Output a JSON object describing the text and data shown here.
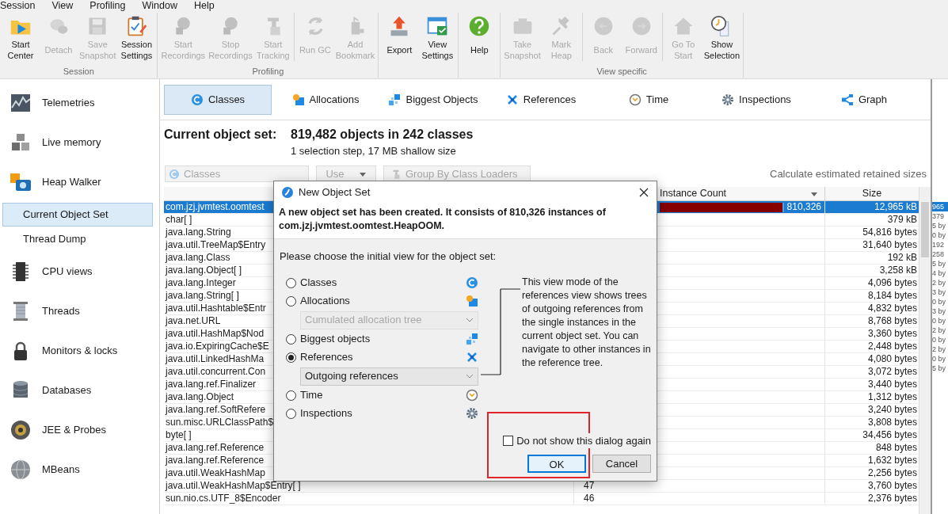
{
  "menu": [
    {
      "label": "Session"
    },
    {
      "label": "View"
    },
    {
      "label": "Profiling"
    },
    {
      "label": "Window"
    },
    {
      "label": "Help"
    }
  ],
  "toolbar": {
    "groups": [
      {
        "label": "Session",
        "sections": [
          [
            {
              "label": "Start\nCenter",
              "disabled": false
            },
            {
              "label": "Detach",
              "disabled": true
            },
            {
              "label": "Save\nSnapshot",
              "disabled": true
            },
            {
              "label": "Session\nSettings",
              "disabled": false
            }
          ]
        ]
      },
      {
        "label": "Profiling",
        "sections": [
          [
            {
              "label": "Start\nRecordings",
              "disabled": true
            },
            {
              "label": "Stop\nRecordings",
              "disabled": true
            },
            {
              "label": "Start\nTracking",
              "disabled": true
            }
          ],
          [
            {
              "label": "Run GC",
              "disabled": true
            },
            {
              "label": "Add\nBookmark",
              "disabled": true
            }
          ]
        ]
      },
      {
        "sections": [
          [
            {
              "label": "Export",
              "disabled": false
            },
            {
              "label": "View\nSettings",
              "disabled": false
            }
          ]
        ]
      },
      {
        "sections": [
          [
            {
              "label": "Help",
              "disabled": false
            }
          ]
        ]
      },
      {
        "label": "View specific",
        "sections": [
          [
            {
              "label": "Take\nSnapshot",
              "disabled": true
            },
            {
              "label": "Mark\nHeap",
              "disabled": true
            }
          ],
          [
            {
              "label": "Back",
              "disabled": true
            },
            {
              "label": "Forward",
              "disabled": true
            }
          ],
          [
            {
              "label": "Go To\nStart",
              "disabled": true
            },
            {
              "label": "Show\nSelection",
              "disabled": false
            }
          ]
        ]
      }
    ]
  },
  "sidebar": {
    "items": [
      {
        "label": "Telemetries",
        "selected": false
      },
      {
        "label": "Live memory",
        "selected": false
      },
      {
        "label": "Heap Walker",
        "selected": false,
        "children": [
          {
            "label": "Current Object Set",
            "selected": true
          },
          {
            "label": "Thread Dump",
            "selected": false
          }
        ]
      },
      {
        "label": "CPU views",
        "selected": false
      },
      {
        "label": "Threads",
        "selected": false
      },
      {
        "label": "Monitors & locks",
        "selected": false
      },
      {
        "label": "Databases",
        "selected": false
      },
      {
        "label": "JEE & Probes",
        "selected": false
      },
      {
        "label": "MBeans",
        "selected": false
      }
    ]
  },
  "view_tabs": [
    {
      "label": "Classes",
      "selected": true
    },
    {
      "label": "Allocations",
      "selected": false
    },
    {
      "label": "Biggest Objects",
      "selected": false
    },
    {
      "label": "References",
      "selected": false
    },
    {
      "label": "Time",
      "selected": false
    },
    {
      "label": "Inspections",
      "selected": false
    },
    {
      "label": "Graph",
      "selected": false
    }
  ],
  "object_set": {
    "label": "Current object set:",
    "summary": "819,482 objects in 242 classes",
    "details": "1 selection step, 17 MB shallow size"
  },
  "controls": {
    "view_select": {
      "value": "Classes",
      "disabled": true
    },
    "use_button": {
      "label": "Use",
      "disabled": true
    },
    "group_button": {
      "label": "Group By Class Loaders",
      "disabled": true
    },
    "retained_link": "Calculate estimated retained sizes"
  },
  "table": {
    "columns": [
      {
        "label": "Instance Count",
        "sorted": true
      },
      {
        "label": "Size",
        "sorted": false
      }
    ],
    "rows": [
      {
        "name": "com.jzj.jvmtest.oomtest",
        "count": "810,326",
        "level": 0.99,
        "size": "12,965 kB",
        "selected": true
      },
      {
        "name": "char[ ]",
        "size": "379 kB",
        "selected": false
      },
      {
        "name": "java.lang.String",
        "size": "54,816 bytes",
        "selected": false
      },
      {
        "name": "java.util.TreeMap$Entry",
        "size": "31,640 bytes",
        "selected": false
      },
      {
        "name": "java.lang.Class",
        "size": "192 kB",
        "selected": false
      },
      {
        "name": "java.lang.Object[ ]",
        "size": "3,258 kB",
        "selected": false
      },
      {
        "name": "java.lang.Integer",
        "size": "4,096 bytes",
        "selected": false
      },
      {
        "name": "java.lang.String[ ]",
        "size": "8,184 bytes",
        "selected": false
      },
      {
        "name": "java.util.Hashtable$Entr",
        "size": "4,832 bytes",
        "selected": false
      },
      {
        "name": "java.net.URL",
        "size": "8,768 bytes",
        "selected": false
      },
      {
        "name": "java.util.HashMap$Nod",
        "size": "3,360 bytes",
        "selected": false
      },
      {
        "name": "java.io.ExpiringCache$E",
        "size": "2,448 bytes",
        "selected": false
      },
      {
        "name": "java.util.LinkedHashMa",
        "size": "4,080 bytes",
        "selected": false
      },
      {
        "name": "java.util.concurrent.Con",
        "size": "3,072 bytes",
        "selected": false
      },
      {
        "name": "java.lang.ref.Finalizer",
        "size": "3,440 bytes",
        "selected": false
      },
      {
        "name": "java.lang.Object",
        "size": "1,312 bytes",
        "selected": false
      },
      {
        "name": "java.lang.ref.SoftRefere",
        "size": "3,240 bytes",
        "selected": false
      },
      {
        "name": "sun.misc.URLClassPath$",
        "size": "3,808 bytes",
        "selected": false
      },
      {
        "name": "byte[ ]",
        "size": "34,456 bytes",
        "selected": false
      },
      {
        "name": "java.lang.ref.Reference",
        "size": "848 bytes",
        "selected": false
      },
      {
        "name": "java.lang.ref.Reference",
        "size": "1,632 bytes",
        "selected": false
      },
      {
        "name": "java.util.WeakHashMap",
        "size": "2,256 bytes",
        "selected": false
      },
      {
        "name": "java.util.WeakHashMap$Entry[ ]",
        "count": "47",
        "size": "3,760 bytes",
        "selected": false
      },
      {
        "name": "sun.nio.cs.UTF_8$Encoder",
        "count": "46",
        "size": "2,376 bytes",
        "selected": false
      }
    ]
  },
  "side_strip": [
    {
      "text": "965",
      "selected": true
    },
    {
      "text": "379",
      "selected": false
    },
    {
      "text": "5 by",
      "selected": false
    },
    {
      "text": "0 by",
      "selected": false
    },
    {
      "text": "192",
      "selected": false
    },
    {
      "text": "258",
      "selected": false
    },
    {
      "text": "5 by",
      "selected": false
    },
    {
      "text": "4 by",
      "selected": false
    },
    {
      "text": "2 by",
      "selected": false
    },
    {
      "text": "3 by",
      "selected": false
    },
    {
      "text": "0 by",
      "selected": false
    },
    {
      "text": "3 by",
      "selected": false
    },
    {
      "text": "0 by",
      "selected": false
    },
    {
      "text": "2 by",
      "selected": false
    },
    {
      "text": "0 by",
      "selected": false
    },
    {
      "text": "2 by",
      "selected": false
    },
    {
      "text": "0 by",
      "selected": false
    },
    {
      "text": "5 by",
      "selected": false
    }
  ],
  "dialog": {
    "title": "New Object Set",
    "message": "A new object set has been created. It consists of 810,326 instances of com.jzj.jvmtest.oomtest.HeapOOM.",
    "prompt": "Please choose the initial view for the object set:",
    "options": [
      {
        "label": "Classes",
        "selected": false
      },
      {
        "label": "Allocations",
        "selected": false,
        "dropdown": {
          "value": "Cumulated allocation tree",
          "disabled": true
        }
      },
      {
        "label": "Biggest objects",
        "selected": false
      },
      {
        "label": "References",
        "selected": true,
        "dropdown": {
          "value": "Outgoing references",
          "disabled": false
        }
      },
      {
        "label": "Time",
        "selected": false
      },
      {
        "label": "Inspections",
        "selected": false
      }
    ],
    "help": "This view mode of the references view shows trees of outgoing references from the single instances in the current object set. You can navigate to other instances in the reference tree.",
    "dont_show_again": {
      "label": "Do not show this dialog again",
      "checked": false
    },
    "buttons": [
      {
        "label": "OK",
        "default": true
      },
      {
        "label": "Cancel",
        "default": false
      }
    ],
    "highlighted": true
  }
}
